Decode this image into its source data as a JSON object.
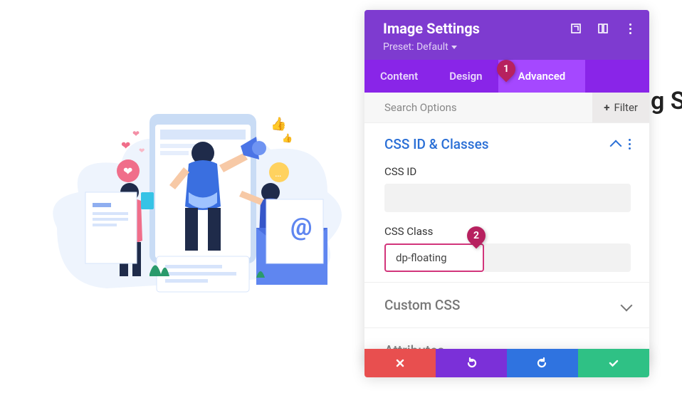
{
  "bg_text": "g S",
  "panel": {
    "title": "Image Settings",
    "preset_label": "Preset: Default"
  },
  "tabs": {
    "content": "Content",
    "design": "Design",
    "advanced": "Advanced"
  },
  "search": {
    "placeholder": "Search Options",
    "filter_label": "Filter"
  },
  "section_cssid": {
    "title": "CSS ID & Classes",
    "field_id_label": "CSS ID",
    "field_id_value": "",
    "field_class_label": "CSS Class",
    "field_class_value": "dp-floating"
  },
  "section_custom": {
    "title": "Custom CSS"
  },
  "section_attr": {
    "title": "Attributes"
  },
  "pills": {
    "one": "1",
    "two": "2"
  }
}
